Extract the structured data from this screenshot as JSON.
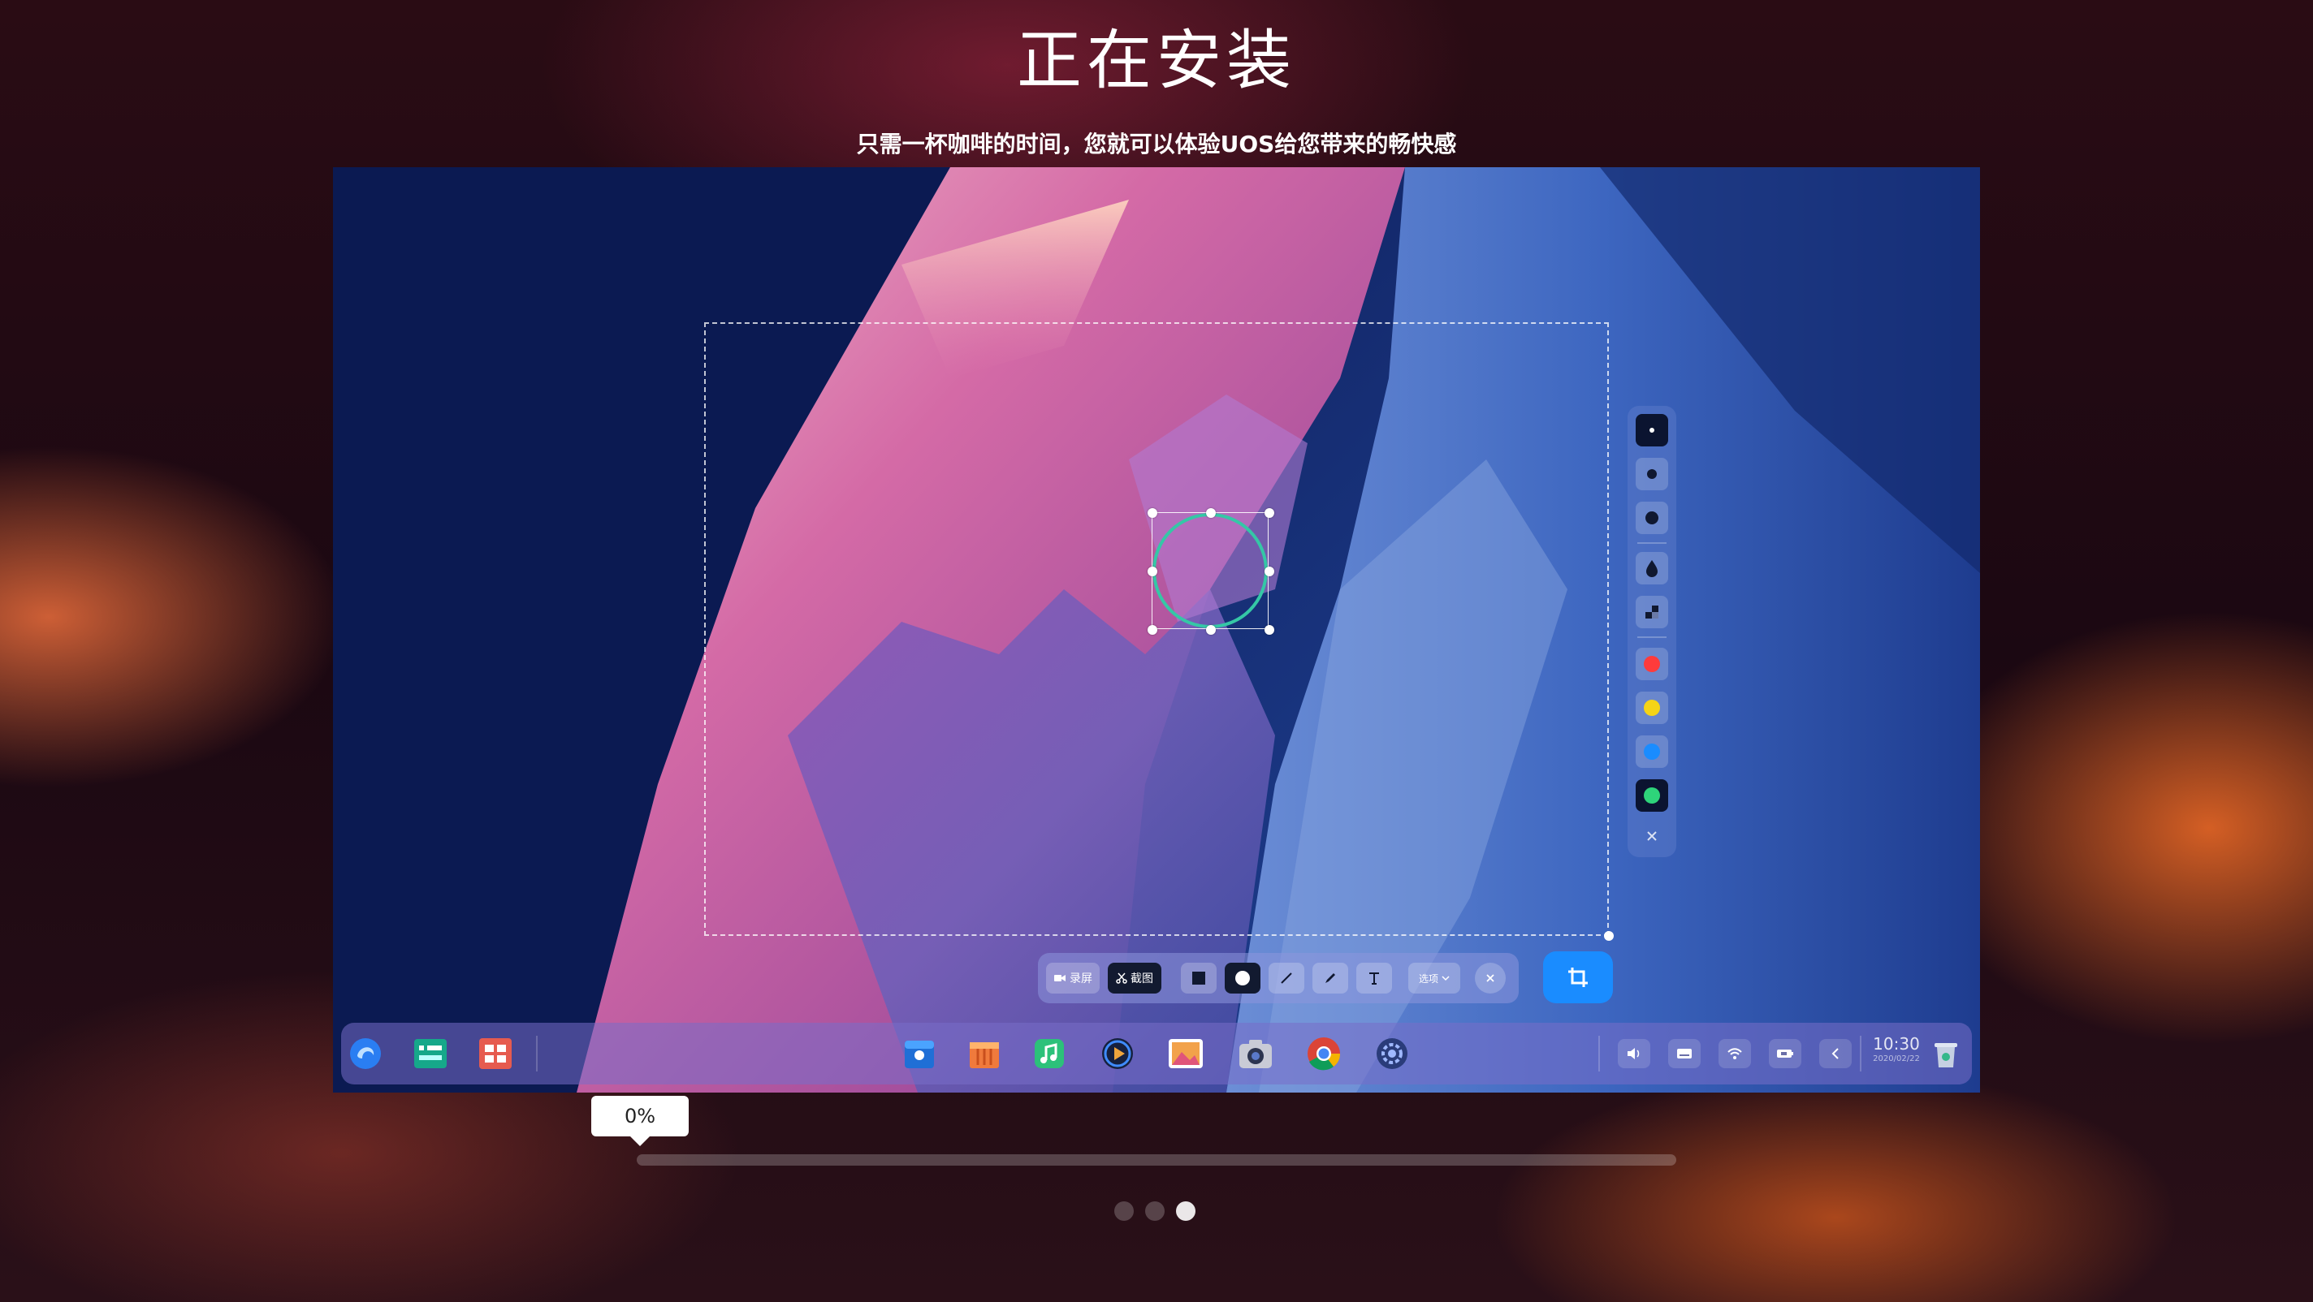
{
  "header": {
    "title": "正在安装",
    "subtitle": "只需一杯咖啡的时间，您就可以体验UOS给您带来的畅快感"
  },
  "preview": {
    "screenshot_toolbar": {
      "record_label": "录屏",
      "screenshot_label": "截图",
      "options_label": "选项"
    },
    "palette_colors": [
      "#ff3b3b",
      "#f5d416",
      "#1a8cff",
      "#2ed47a"
    ],
    "dock": {
      "clock_time": "10:30",
      "clock_date": "2020/02/22"
    }
  },
  "progress": {
    "percent_label": "0%",
    "value": 0
  },
  "pagination": {
    "total": 3,
    "active_index": 2
  },
  "colors": {
    "accent": "#1a8cff",
    "selection_ring": "#35c7a6"
  }
}
